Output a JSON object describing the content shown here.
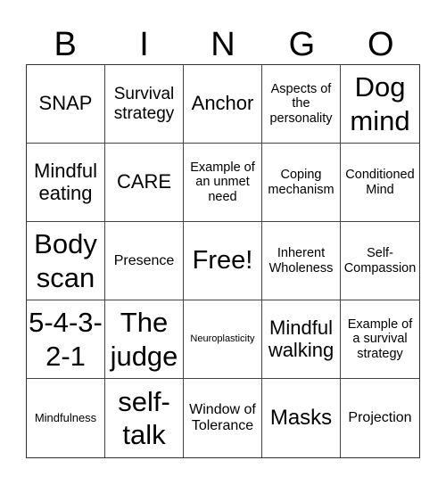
{
  "header": {
    "letters": [
      "B",
      "I",
      "N",
      "G",
      "O"
    ]
  },
  "cells": [
    "SNAP",
    "Survival strategy",
    "Anchor",
    "Aspects of the personality",
    "Dog mind",
    "Mindful eating",
    "CARE",
    "Example of an unmet need",
    "Coping mechanism",
    "Conditioned Mind",
    "Body scan",
    "Presence",
    "Free!",
    "Inherent Wholeness",
    "Self-Compassion",
    "5-4-3-2-1",
    "The judge",
    "Neuroplasticity",
    "Mindful walking",
    "Example of a survival strategy",
    "Mindfulness",
    "self-talk",
    "Window of Tolerance",
    "Masks",
    "Projection"
  ]
}
